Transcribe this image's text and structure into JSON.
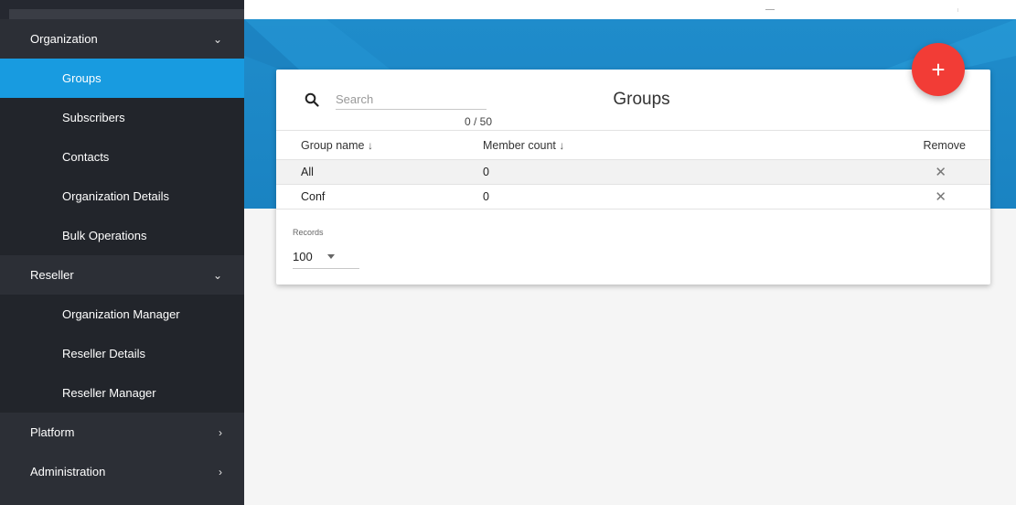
{
  "sidebar": {
    "sections": [
      {
        "label": "Organization",
        "chevron": "chevron-down-icon",
        "items": [
          "Groups",
          "Subscribers",
          "Contacts",
          "Organization Details",
          "Bulk Operations"
        ]
      },
      {
        "label": "Reseller",
        "chevron": "chevron-down-icon",
        "items": [
          "Organization Manager",
          "Reseller Details",
          "Reseller Manager"
        ]
      },
      {
        "label": "Platform",
        "chevron": "chevron-right-icon"
      },
      {
        "label": "Administration",
        "chevron": "chevron-right-icon"
      }
    ],
    "active_item": "Groups"
  },
  "card": {
    "title": "Groups",
    "search": {
      "placeholder": "Search",
      "value": "",
      "counter": "0 / 50",
      "icon": "search-icon"
    },
    "add_button": {
      "label": "+",
      "icon": "plus-icon",
      "color": "#f23c36"
    },
    "table": {
      "headers": [
        "Group name",
        "Member count",
        "Remove"
      ],
      "sort_arrow": "↓",
      "rows": [
        {
          "name": "All",
          "member_count": "0",
          "remove": "✕"
        },
        {
          "name": "Conf",
          "member_count": "0",
          "remove": "✕"
        }
      ]
    },
    "records": {
      "label": "Records",
      "value": "100"
    }
  },
  "colors": {
    "accent": "#189be0",
    "sidebar_bg": "#2c2f36",
    "banner": "#1f8ccb",
    "fab": "#f23c36"
  }
}
